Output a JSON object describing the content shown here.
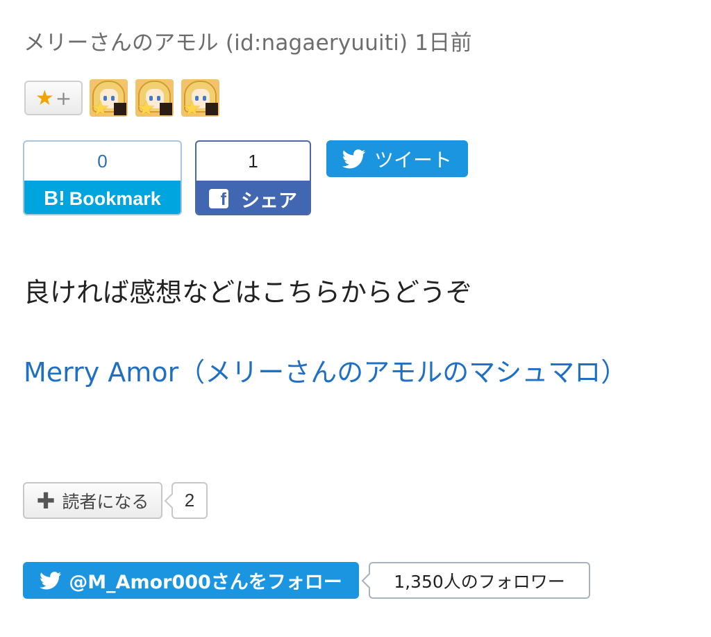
{
  "author": {
    "line": "メリーさんのアモル (id:nagaeryuuiti) 1日前"
  },
  "stars": {
    "add_star": "★",
    "add_plus": "+",
    "avatar_count": 3
  },
  "hatena_bookmark": {
    "count": "0",
    "logo": "B!",
    "label": "Bookmark"
  },
  "facebook": {
    "count": "1",
    "icon": "f",
    "label": "シェア"
  },
  "tweet": {
    "label": "ツイート"
  },
  "body": {
    "request_text": "良ければ感想などはこちらからどうぞ",
    "link_text": "Merry Amor（メリーさんのアモルのマシュマロ）"
  },
  "reader": {
    "icon": "✚",
    "label": "読者になる",
    "count": "2"
  },
  "twitter_follow": {
    "label": "@M_Amor000さんをフォロー",
    "followers": "1,350人のフォロワー"
  },
  "colors": {
    "link": "#1f6fc5",
    "twitter": "#1b95e0",
    "hatena": "#00a4de",
    "facebook": "#4267b2"
  }
}
